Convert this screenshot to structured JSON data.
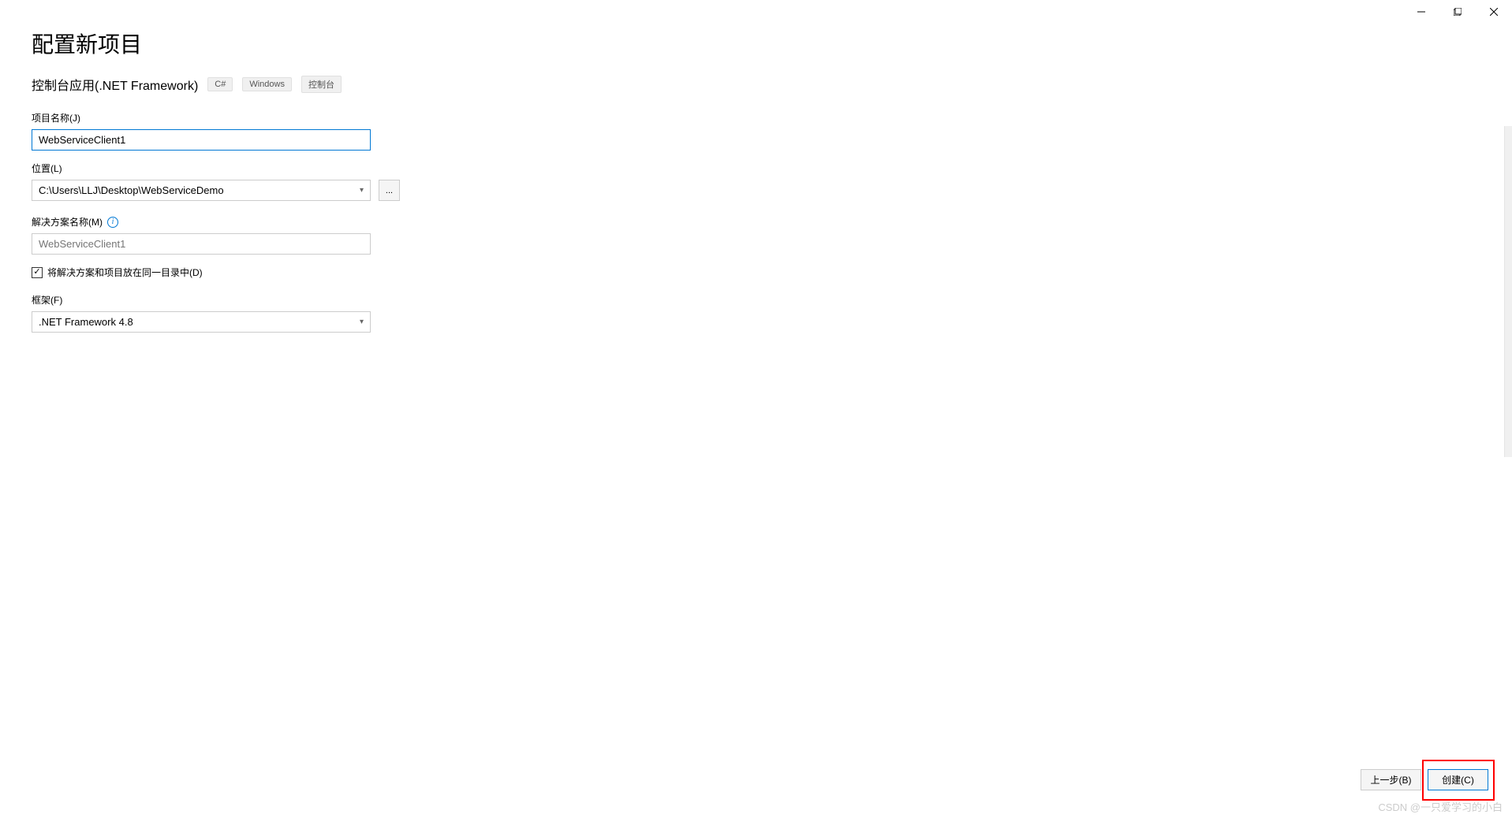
{
  "window": {
    "minimize": "−",
    "maximize": "❐",
    "close": "✕"
  },
  "page": {
    "title": "配置新项目",
    "subtitle": "控制台应用(.NET Framework)",
    "tags": [
      "C#",
      "Windows",
      "控制台"
    ]
  },
  "fields": {
    "projectName": {
      "label": "项目名称(J)",
      "value": "WebServiceClient1"
    },
    "location": {
      "label": "位置(L)",
      "value": "C:\\Users\\LLJ\\Desktop\\WebServiceDemo",
      "browse": "..."
    },
    "solutionName": {
      "label": "解决方案名称(M)",
      "placeholder": "WebServiceClient1"
    },
    "sameDirectory": {
      "label": "将解决方案和项目放在同一目录中(D)",
      "checked": true
    },
    "framework": {
      "label": "框架(F)",
      "value": ".NET Framework 4.8"
    }
  },
  "footer": {
    "back": "上一步(B)",
    "create": "创建(C)"
  },
  "watermark": "CSDN @一只爱学习的小白"
}
